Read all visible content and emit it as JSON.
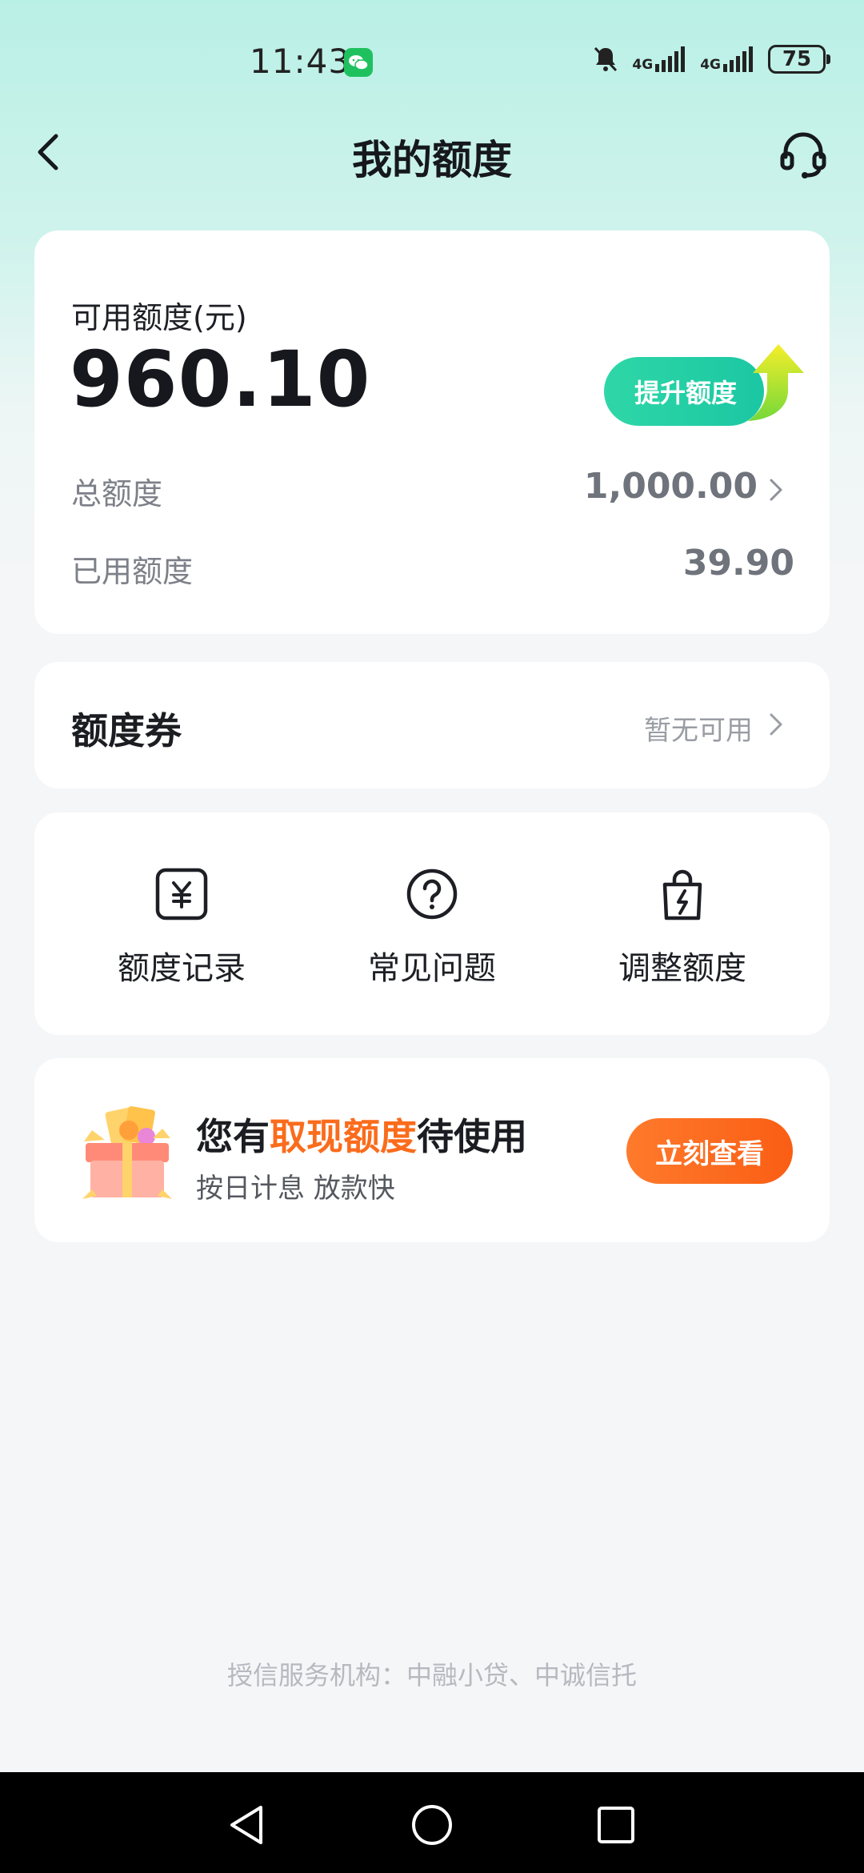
{
  "status_bar": {
    "time": "11:43",
    "network_1": "4G",
    "network_2": "4G",
    "battery": "75"
  },
  "header": {
    "title": "我的额度"
  },
  "quota_card": {
    "available_label": "可用额度(元)",
    "available_amount": "960.10",
    "raise_button": "提升额度",
    "total_label": "总额度",
    "total_value": "1,000.00",
    "used_label": "已用额度",
    "used_value": "39.90"
  },
  "coupon": {
    "title": "额度券",
    "status": "暂无可用"
  },
  "actions": [
    {
      "label": "额度记录",
      "icon": "yuan-record-icon"
    },
    {
      "label": "常见问题",
      "icon": "question-icon"
    },
    {
      "label": "调整额度",
      "icon": "adjust-bag-icon"
    }
  ],
  "promo": {
    "title_prefix": "您有",
    "title_highlight": "取现额度",
    "title_suffix": "待使用",
    "subtitle": "按日计息 放款快",
    "button": "立刻查看"
  },
  "footer": {
    "note": "授信服务机构：中融小贷、中诚信托"
  },
  "colors": {
    "accent_green": "#2fd7a7",
    "accent_orange": "#fa6c1c",
    "header_gradient_top": "#b9f0e6"
  }
}
